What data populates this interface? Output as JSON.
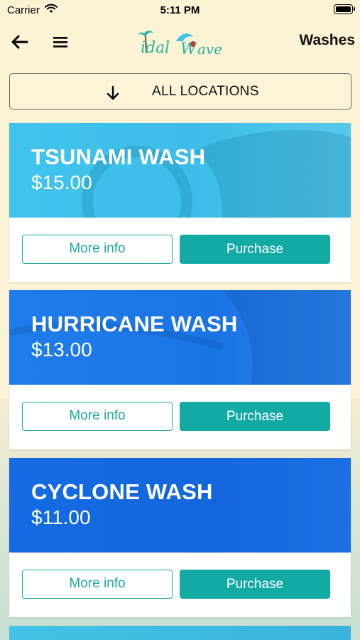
{
  "status_bar": {
    "carrier": "Carrier",
    "time": "5:11 PM"
  },
  "nav": {
    "title": "Washes",
    "back_icon": "arrow-left-icon",
    "menu_icon": "hamburger-icon",
    "logo_text": "Tidal Wave"
  },
  "location_filter": {
    "label": "ALL LOCATIONS",
    "icon": "arrow-down-icon"
  },
  "washes": [
    {
      "name": "TSUNAMI WASH",
      "price": "$15.00",
      "more_info": "More info",
      "purchase": "Purchase",
      "banner_color": "#3ec2ea"
    },
    {
      "name": "HURRICANE WASH",
      "price": "$13.00",
      "more_info": "More info",
      "purchase": "Purchase",
      "banner_color": "#1f7bea"
    },
    {
      "name": "CYCLONE WASH",
      "price": "$11.00",
      "more_info": "More info",
      "purchase": "Purchase",
      "banner_color": "#1569e0"
    }
  ],
  "colors": {
    "accent": "#13aaa3",
    "background": "#fcf2d4"
  }
}
